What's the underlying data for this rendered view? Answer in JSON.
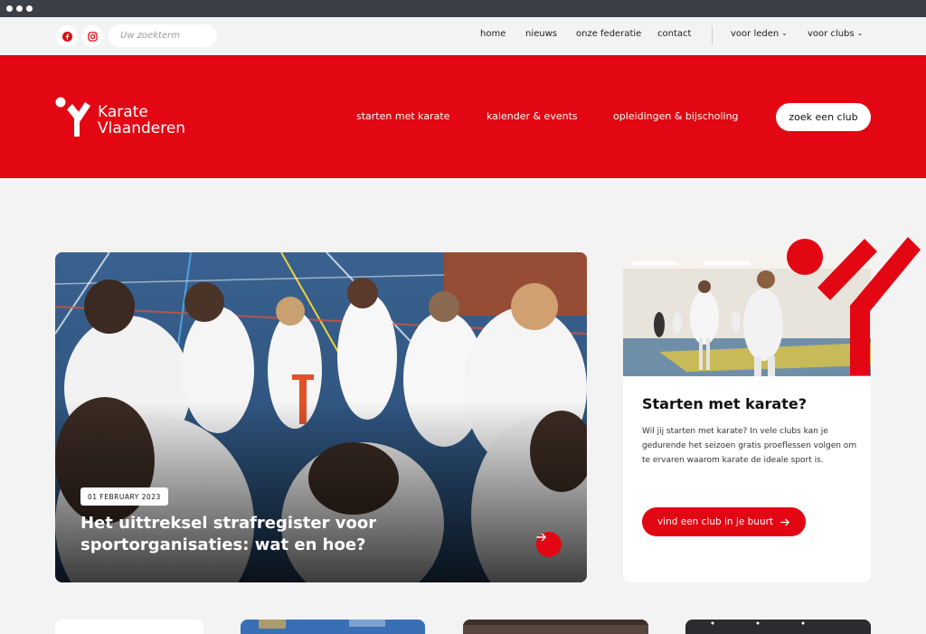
{
  "utility": {
    "search_placeholder": "Uw zoekterm",
    "links": [
      "home",
      "nieuws",
      "onze federatie",
      "contact"
    ],
    "dropdowns": [
      "voor leden",
      "voor clubs"
    ]
  },
  "header": {
    "logo_line1": "Karate",
    "logo_line2": "Vlaanderen",
    "nav": [
      "starten met karate",
      "kalender & events",
      "opleidingen & bijscholing"
    ],
    "cta": "zoek een club"
  },
  "hero": {
    "date": "01 FEBRUARY 2023",
    "title": "Het uittreksel strafregister voor sportorganisaties: wat en hoe?"
  },
  "side": {
    "title": "Starten met karate?",
    "text": "Wil jij starten met karate? In vele clubs kan je gedurende het seizoen gratis proeflessen volgen om te ervaren waarom karate de ideale sport is.",
    "button": "vind een club in je buurt"
  },
  "colors": {
    "brand_red": "#e30613",
    "background": "#f3f3f3",
    "browser_bar": "#3b3f46"
  }
}
